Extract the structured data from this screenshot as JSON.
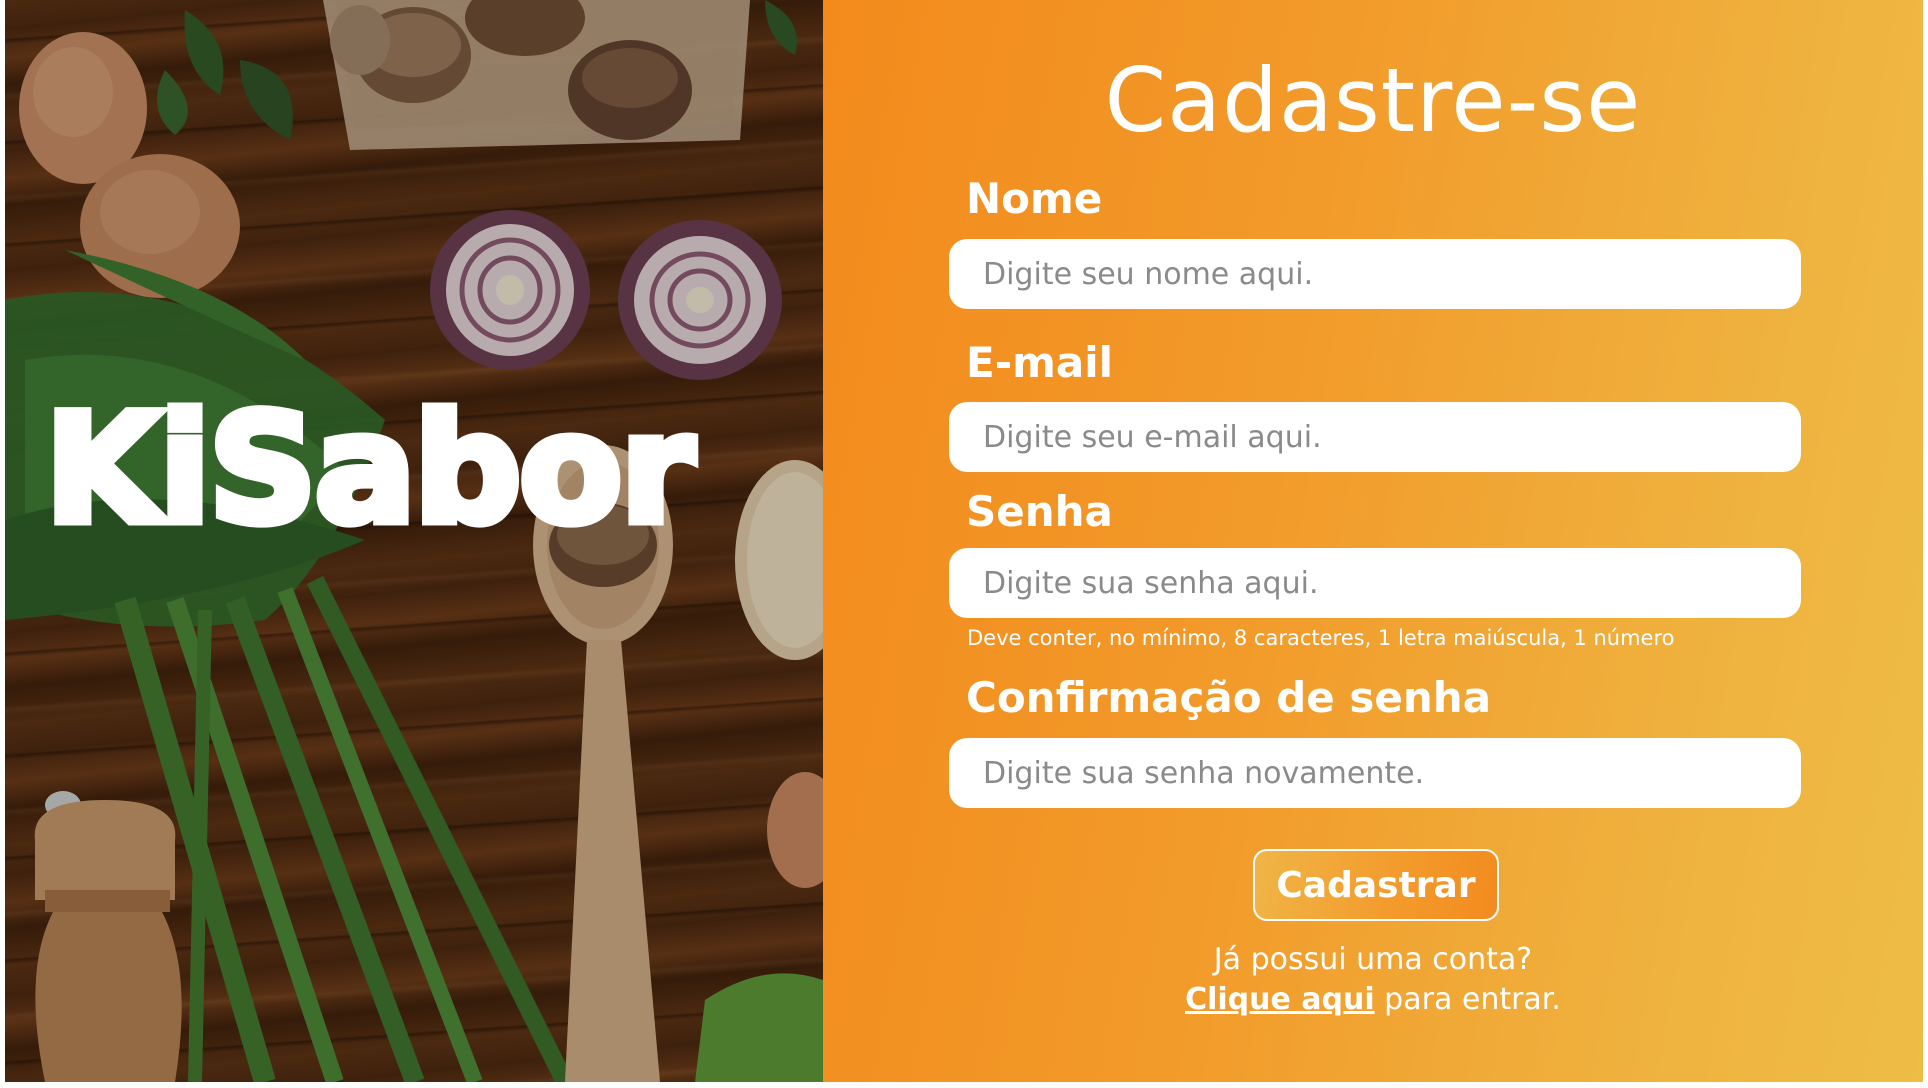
{
  "brand": {
    "logo_text": "KiSabor"
  },
  "signup": {
    "title": "Cadastre-se",
    "name": {
      "label": "Nome",
      "placeholder": "Digite seu nome aqui."
    },
    "email": {
      "label": "E-mail",
      "placeholder": "Digite seu e-mail aqui."
    },
    "password": {
      "label": "Senha",
      "placeholder": "Digite sua senha aqui.",
      "hint": "Deve conter, no mínimo, 8 caracteres, 1 letra maiúscula, 1 número"
    },
    "confirm_password": {
      "label": "Confirmação de senha",
      "placeholder": "Digite sua senha novamente."
    },
    "submit_label": "Cadastrar",
    "login_prompt": "Já possui uma conta?",
    "login_link_label": "Clique aqui",
    "login_suffix": " para entrar."
  },
  "colors": {
    "panel_gradient_start": "#f38a1c",
    "panel_gradient_end": "#eebd45",
    "text": "#ffffff",
    "input_background": "#ffffff",
    "placeholder": "#8a8a8a"
  },
  "icons": {
    "background_photo": "food-ingredients-photo"
  }
}
